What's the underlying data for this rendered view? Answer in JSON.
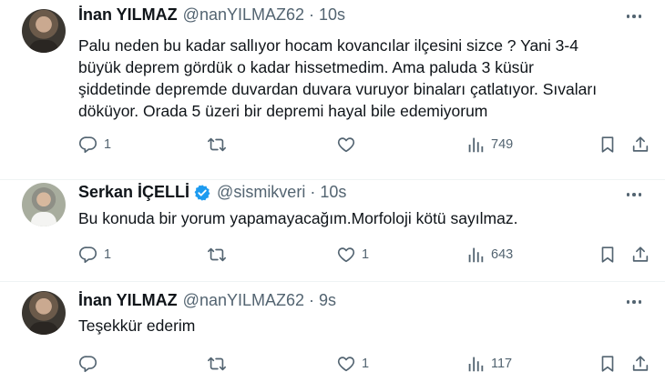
{
  "tweets": [
    {
      "name": "İnan YILMAZ",
      "handle": "@nanYILMAZ62",
      "separator": "·",
      "time": "10s",
      "verified": false,
      "lines": [
        "Palu neden bu kadar sallıyor hocam kovancılar ilçesini sizce ? Yani 3-4",
        "büyük deprem gördük o kadar hissetmedim. Ama paluda 3 küsür",
        "şiddetinde depremde duvardan duvara vuruyor binaları çatlatıyor.  Sıvaları",
        "döküyor. Orada 5 üzeri bir depremi hayal bile edemiyorum"
      ],
      "replies": "1",
      "retweets": "",
      "likes": "",
      "views": "749"
    },
    {
      "name": "Serkan İÇELLİ",
      "handle": "@sismikveri",
      "separator": "·",
      "time": "10s",
      "verified": true,
      "lines": [
        "Bu konuda bir yorum yapamayacağım.Morfoloji kötü sayılmaz."
      ],
      "replies": "1",
      "retweets": "",
      "likes": "1",
      "views": "643"
    },
    {
      "name": "İnan YILMAZ",
      "handle": "@nanYILMAZ62",
      "separator": "·",
      "time": "9s",
      "verified": false,
      "lines": [
        "Teşekkür ederim"
      ],
      "replies": "",
      "retweets": "",
      "likes": "1",
      "views": "117"
    }
  ],
  "icons": {
    "reply": "reply-icon",
    "retweet": "retweet-icon",
    "like": "heart-icon",
    "views": "views-icon",
    "bookmark": "bookmark-icon",
    "share": "share-icon",
    "more": "more-icon",
    "verified": "verified-badge-icon"
  },
  "colors": {
    "text": "#0f1419",
    "secondary": "#536471",
    "verified": "#1d9bf0",
    "divider": "#eff3f4"
  }
}
